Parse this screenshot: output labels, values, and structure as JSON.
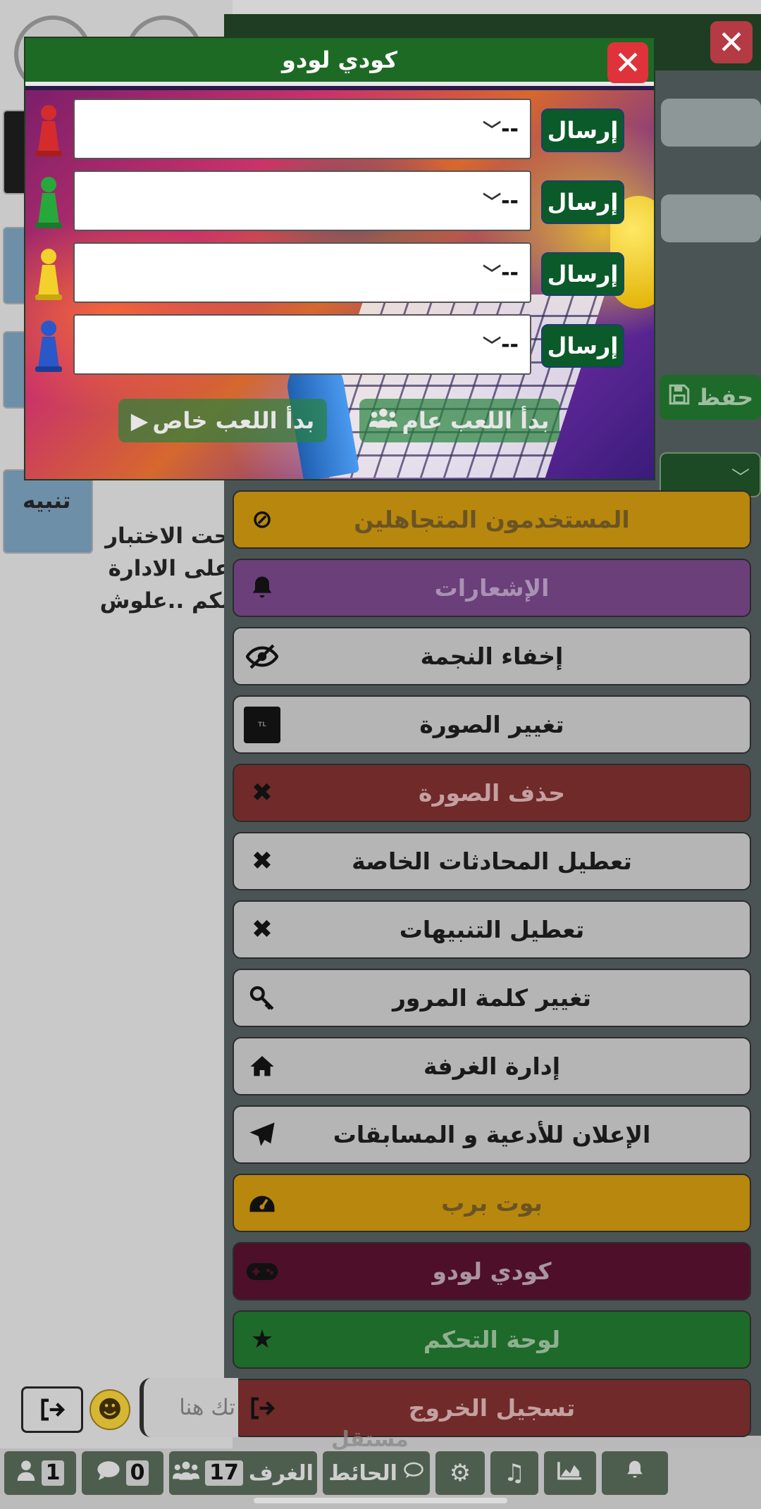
{
  "chat": {
    "lines": [
      "تنبيه",
      "حت الاختبار",
      "على الادارة",
      "نكم ..علوش"
    ]
  },
  "ludo": {
    "title": "كودي لودو",
    "rows": [
      {
        "color": "#d42c2c",
        "value": "--",
        "send_label": "إرسال"
      },
      {
        "color": "#27a83c",
        "value": "--",
        "send_label": "إرسال"
      },
      {
        "color": "#f2d12a",
        "value": "--",
        "send_label": "إرسال"
      },
      {
        "color": "#2a58c9",
        "value": "--",
        "send_label": "إرسال"
      }
    ],
    "play_private_label": "بدأ اللعب خاص",
    "play_public_label": "بدأ اللعب عام"
  },
  "panel": {
    "save_label": "حفظ"
  },
  "menu": [
    {
      "label": "المستخدمون المتجاهلين",
      "icon": "ban-icon",
      "bg": "#b8870d",
      "fg": "#6a5424"
    },
    {
      "label": "الإشعارات",
      "icon": "bell-icon",
      "bg": "#6a3f7a",
      "fg": "#a991b3"
    },
    {
      "label": "إخفاء النجمة",
      "icon": "eye-slash-icon",
      "bg": "#b5b5b5",
      "fg": "#1a1a1a"
    },
    {
      "label": "تغيير الصورة",
      "icon": "image-icon",
      "bg": "#b5b5b5",
      "fg": "#1a1a1a"
    },
    {
      "label": "حذف الصورة",
      "icon": "x-icon",
      "bg": "#702a2a",
      "fg": "#c4a0a0"
    },
    {
      "label": "تعطيل المحادثات الخاصة",
      "icon": "x-icon",
      "bg": "#b5b5b5",
      "fg": "#1a1a1a"
    },
    {
      "label": "تعطيل التنبيهات",
      "icon": "x-icon",
      "bg": "#b5b5b5",
      "fg": "#1a1a1a"
    },
    {
      "label": "تغيير كلمة المرور",
      "icon": "key-icon",
      "bg": "#b5b5b5",
      "fg": "#1a1a1a"
    },
    {
      "label": "إدارة الغرفة",
      "icon": "home-icon",
      "bg": "#b5b5b5",
      "fg": "#1a1a1a"
    },
    {
      "label": "الإعلان للأدعية و المسابقات",
      "icon": "paper-plane-icon",
      "bg": "#b5b5b5",
      "fg": "#1a1a1a"
    },
    {
      "label": "بوت برب",
      "icon": "dashboard-icon",
      "bg": "#b8870d",
      "fg": "#6a5424"
    },
    {
      "label": "كودي لودو",
      "icon": "gamepad-icon",
      "bg": "#4e0f2a",
      "fg": "#a895a0"
    },
    {
      "label": "لوحة التحكم",
      "icon": "star-icon",
      "bg": "#1e6a2a",
      "fg": "#8fb08f"
    },
    {
      "label": "تسجيل الخروج",
      "icon": "sign-out-icon",
      "bg": "#702a2a",
      "fg": "#c4a0a0"
    }
  ],
  "composer": {
    "placeholder": "تك هنا"
  },
  "bottom_bar": {
    "users_count": "1",
    "messages_count": "0",
    "rooms_label": "الغرف",
    "rooms_count": "17",
    "wall_label": "الحائط"
  },
  "watermark": "مستقل"
}
